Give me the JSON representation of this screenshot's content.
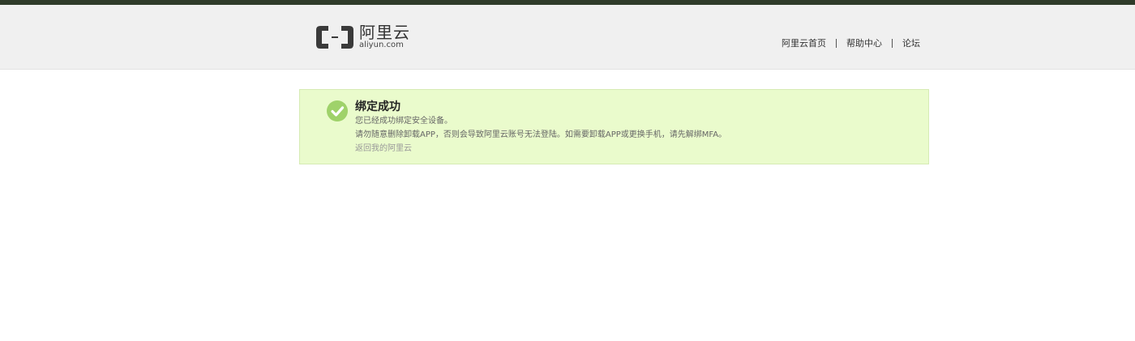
{
  "logo": {
    "cn": "阿里云",
    "en": "aliyun.com"
  },
  "nav": [
    {
      "label": "阿里云首页"
    },
    {
      "label": "帮助中心"
    },
    {
      "label": "论坛"
    }
  ],
  "alert": {
    "title": "绑定成功",
    "line1": "您已经成功绑定安全设备。",
    "line2": "请勿随意删除卸载APP，否则会导致阿里云账号无法登陆。如需要卸载APP或更换手机，请先解绑MFA。",
    "back_link": "返回我的阿里云"
  },
  "colors": {
    "topbar": "#2f3b2a",
    "alert_bg": "#eafbcc",
    "check": "#9fd26a"
  }
}
